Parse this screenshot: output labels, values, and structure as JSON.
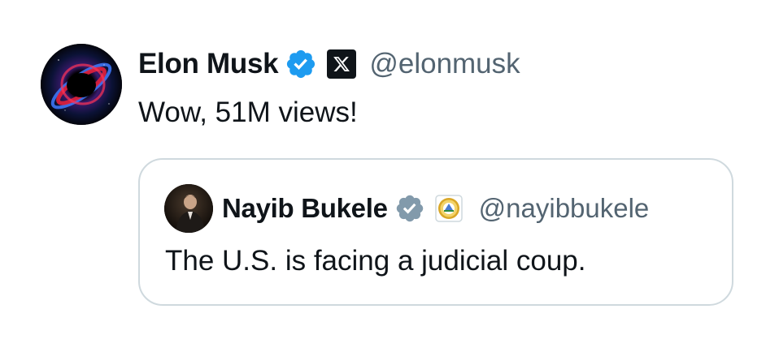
{
  "tweet": {
    "author": {
      "name": "Elon Musk",
      "handle": "@elonmusk",
      "verified_badge": "verified-blue-icon",
      "affiliation_badge": "x-logo-icon",
      "avatar": "black-hole-avatar"
    },
    "text": "Wow, 51M views!",
    "quoted_tweet": {
      "author": {
        "name": "Nayib Bukele",
        "handle": "@nayibbukele",
        "verified_badge": "verified-gray-icon",
        "affiliation_badge": "el-salvador-seal-icon",
        "avatar": "nayib-bukele-avatar"
      },
      "text": "The U.S. is facing a judicial coup."
    }
  },
  "colors": {
    "text_primary": "#0f1419",
    "text_secondary": "#536471",
    "verified_blue": "#1d9bf0",
    "verified_gray": "#829aab",
    "card_border": "#cfd9de"
  }
}
